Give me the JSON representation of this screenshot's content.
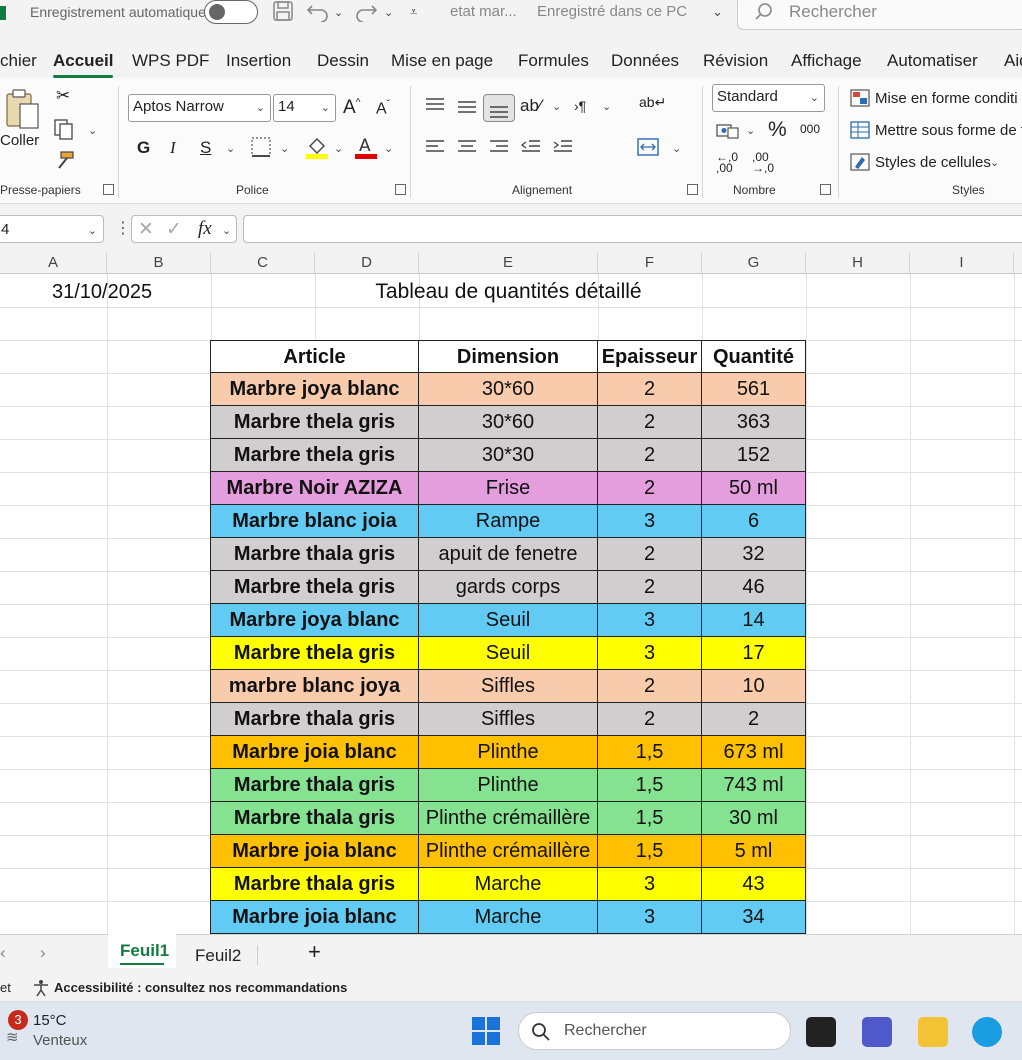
{
  "titlebar": {
    "autosave_label": "Enregistrement automatique",
    "doc_name": "etat mar...",
    "save_status": "Enregistré dans ce PC",
    "search_placeholder": "Rechercher"
  },
  "tabs": [
    "chier",
    "Accueil",
    "WPS PDF",
    "Insertion",
    "Dessin",
    "Mise en page",
    "Formules",
    "Données",
    "Révision",
    "Affichage",
    "Automatiser",
    "Aid"
  ],
  "active_tab": "Accueil",
  "ribbon": {
    "clipboard": {
      "paste_label": "Coller",
      "group_label": "Presse-papiers"
    },
    "font": {
      "font_name": "Aptos Narrow",
      "font_size": "14",
      "bold": "G",
      "italic": "I",
      "underline": "S",
      "group_label": "Police"
    },
    "alignment": {
      "group_label": "Alignement"
    },
    "number": {
      "format": "Standard",
      "percent": "%",
      "thousands": "000",
      "group_label": "Nombre"
    },
    "styles": {
      "conditional": "Mise en forme conditi",
      "as_table": "Mettre sous forme de t",
      "cell_styles": "Styles de cellules",
      "group_label": "Styles"
    }
  },
  "formulabar": {
    "name_box": "4",
    "fx": "fx",
    "content": ""
  },
  "columns": [
    "A",
    "B",
    "C",
    "D",
    "E",
    "F",
    "G",
    "H",
    "I"
  ],
  "sheet": {
    "date": "31/10/2025",
    "title": "Tableau de quantités détaillé",
    "headers": [
      "Article",
      "Dimension",
      "Epaisseur",
      "Quantité"
    ],
    "rows": [
      {
        "article": "Marbre joya blanc",
        "dimension": "30*60",
        "epaisseur": "2",
        "quantite": "561",
        "color": "#f8cbad"
      },
      {
        "article": "Marbre thela gris",
        "dimension": "30*60",
        "epaisseur": "2",
        "quantite": "363",
        "color": "#d0cece"
      },
      {
        "article": "Marbre thela gris",
        "dimension": "30*30",
        "epaisseur": "2",
        "quantite": "152",
        "color": "#d0cece"
      },
      {
        "article": "Marbre Noir AZIZA",
        "dimension": "Frise",
        "epaisseur": "2",
        "quantite": "50 ml",
        "color": "#e59edd"
      },
      {
        "article": "Marbre blanc joia",
        "dimension": "Rampe",
        "epaisseur": "3",
        "quantite": "6",
        "color": "#61cbf3"
      },
      {
        "article": "Marbre thala gris",
        "dimension": "apuit de fenetre",
        "epaisseur": "2",
        "quantite": "32",
        "color": "#d0cece"
      },
      {
        "article": "Marbre thela gris",
        "dimension": "gards corps",
        "epaisseur": "2",
        "quantite": "46",
        "color": "#d0cece"
      },
      {
        "article": "Marbre joya blanc",
        "dimension": "Seuil",
        "epaisseur": "3",
        "quantite": "14",
        "color": "#61cbf3"
      },
      {
        "article": "Marbre thela gris",
        "dimension": "Seuil",
        "epaisseur": "3",
        "quantite": "17",
        "color": "#ffff00"
      },
      {
        "article": "marbre blanc joya",
        "dimension": "Siffles",
        "epaisseur": "2",
        "quantite": "10",
        "color": "#f8cbad"
      },
      {
        "article": "Marbre thala gris",
        "dimension": "Siffles",
        "epaisseur": "2",
        "quantite": "2",
        "color": "#d0cece"
      },
      {
        "article": "Marbre joia blanc",
        "dimension": "Plinthe",
        "epaisseur": "1,5",
        "quantite": "673 ml",
        "color": "#ffc000"
      },
      {
        "article": "Marbre thala gris",
        "dimension": "Plinthe",
        "epaisseur": "1,5",
        "quantite": "743 ml",
        "color": "#84e291"
      },
      {
        "article": "Marbre thala gris",
        "dimension": "Plinthe crémaillère",
        "epaisseur": "1,5",
        "quantite": "30 ml",
        "color": "#84e291"
      },
      {
        "article": "Marbre joia blanc",
        "dimension": "Plinthe crémaillère",
        "epaisseur": "1,5",
        "quantite": "5 ml",
        "color": "#ffc000"
      },
      {
        "article": "Marbre thala gris",
        "dimension": "Marche",
        "epaisseur": "3",
        "quantite": "43",
        "color": "#ffff00"
      },
      {
        "article": "Marbre joia blanc",
        "dimension": "Marche",
        "epaisseur": "3",
        "quantite": "34",
        "color": "#61cbf3"
      }
    ]
  },
  "sheettabs": {
    "tabs": [
      "Feuil1",
      "Feuil2"
    ],
    "active": "Feuil1",
    "add": "+"
  },
  "statusbar": {
    "accessibility": "Accessibilité : consultez nos recommandations",
    "left_fragment": "et"
  },
  "taskbar": {
    "weather_temp": "15°C",
    "weather_desc": "Venteux",
    "badge": "3",
    "search_placeholder": "Rechercher"
  },
  "colors": {
    "accent": "#107c41",
    "border": "#222222"
  }
}
